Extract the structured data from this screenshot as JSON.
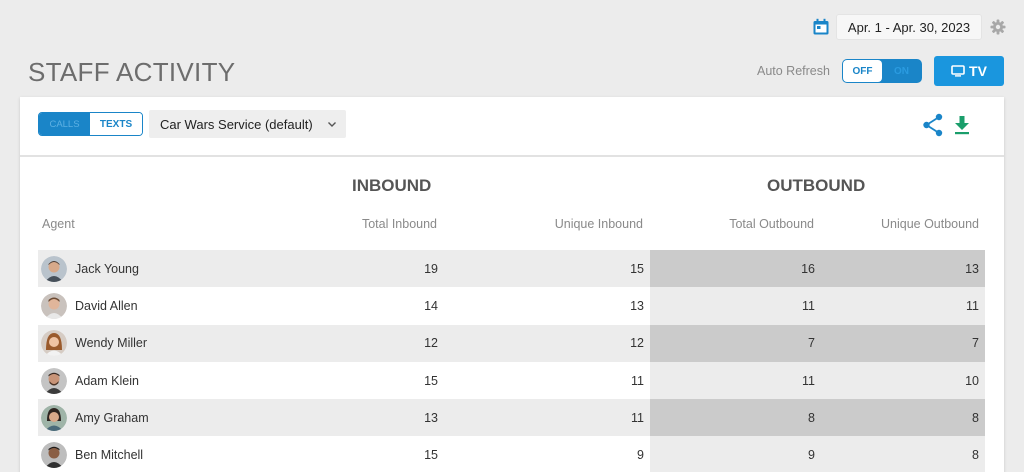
{
  "header": {
    "date_range": "Apr. 1 - Apr. 30, 2023",
    "title": "STAFF ACTIVITY",
    "auto_refresh_label": "Auto Refresh",
    "toggle_off": "OFF",
    "toggle_on": "ON",
    "tv_label": "TV"
  },
  "toolbar": {
    "calls_label": "CALLS",
    "texts_label": "TEXTS",
    "service_selected": "Car Wars Service (default)"
  },
  "table": {
    "group_inbound": "INBOUND",
    "group_outbound": "OUTBOUND",
    "columns": [
      "Agent",
      "Total Inbound",
      "Unique Inbound",
      "Total Outbound",
      "Unique Outbound"
    ],
    "rows": [
      {
        "agent": "Jack Young",
        "total_inbound": "19",
        "unique_inbound": "15",
        "total_outbound": "16",
        "unique_outbound": "13"
      },
      {
        "agent": "David Allen",
        "total_inbound": "14",
        "unique_inbound": "13",
        "total_outbound": "11",
        "unique_outbound": "11"
      },
      {
        "agent": "Wendy Miller",
        "total_inbound": "12",
        "unique_inbound": "12",
        "total_outbound": "7",
        "unique_outbound": "7"
      },
      {
        "agent": "Adam Klein",
        "total_inbound": "15",
        "unique_inbound": "11",
        "total_outbound": "11",
        "unique_outbound": "10"
      },
      {
        "agent": "Amy Graham",
        "total_inbound": "13",
        "unique_inbound": "11",
        "total_outbound": "8",
        "unique_outbound": "8"
      },
      {
        "agent": "Ben Mitchell",
        "total_inbound": "15",
        "unique_inbound": "9",
        "total_outbound": "9",
        "unique_outbound": "8"
      }
    ]
  },
  "colors": {
    "accent": "#1a85c8",
    "download": "#1a9e6b",
    "outbound_shade": "#cbcbcb"
  },
  "icons": [
    "calendar-icon",
    "gear-icon",
    "tv-icon",
    "chevron-down-icon",
    "share-icon",
    "download-icon"
  ]
}
